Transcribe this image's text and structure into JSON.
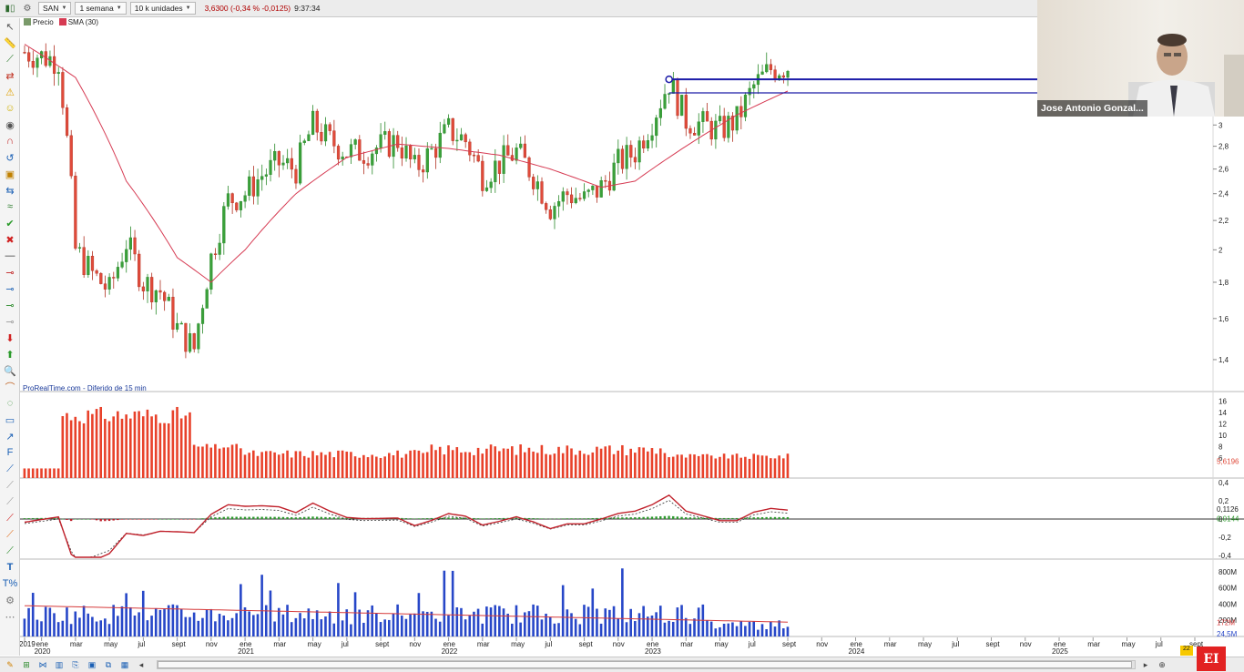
{
  "toolbar": {
    "ticker": "SAN",
    "period": "1 semana",
    "units": "10 k unidades",
    "price_change": "3,6300 (-0,34 % -0,0125)",
    "time": "9:37:34"
  },
  "legend": {
    "price_label": "Precio",
    "sma_label": "SMA (30)",
    "price_color": "#2b8a2b",
    "sma_color": "#d63a52"
  },
  "watermark": "ProRealTime.com - Diferido de 15 min",
  "webcam": {
    "name": "Jose Antonio Gonzal..."
  },
  "badge": "22",
  "logo": "EI",
  "chart_data": [
    {
      "type": "candlestick",
      "title": "",
      "y_ticks": [
        "3",
        "2,8",
        "2,6",
        "2,4",
        "2,2",
        "2",
        "1,8",
        "1,6",
        "1,4"
      ],
      "ylim": [
        1.3,
        3.2
      ],
      "y_scale": "log",
      "x_ticks": [
        "2019",
        "ene",
        "mar",
        "may",
        "jul",
        "sept",
        "nov",
        "ene",
        "mar",
        "may",
        "jul",
        "sept",
        "nov",
        "ene",
        "mar",
        "may",
        "jul",
        "sept",
        "nov",
        "ene",
        "mar",
        "may",
        "jul",
        "sept",
        "nov",
        "ene",
        "mar",
        "may",
        "jul",
        "sept",
        "nov",
        "ene",
        "mar",
        "may",
        "jul",
        "sept"
      ],
      "x_year_labels": [
        "2020",
        "2021",
        "2022",
        "2023",
        "2024",
        "2025"
      ],
      "x_range": [
        "2019-12",
        "2025-09"
      ],
      "series": [
        {
          "name": "Precio",
          "approx_path": [
            [
              "2019-12",
              3.8
            ],
            [
              "2020-02",
              3.7
            ],
            [
              "2020-03",
              2.0
            ],
            [
              "2020-04",
              1.85
            ],
            [
              "2020-05",
              1.75
            ],
            [
              "2020-06",
              2.05
            ],
            [
              "2020-07",
              1.8
            ],
            [
              "2020-08",
              1.75
            ],
            [
              "2020-09",
              1.55
            ],
            [
              "2020-10",
              1.45
            ],
            [
              "2020-11",
              1.95
            ],
            [
              "2020-12",
              2.35
            ],
            [
              "2021-01",
              2.4
            ],
            [
              "2021-02",
              2.55
            ],
            [
              "2021-03",
              2.65
            ],
            [
              "2021-04",
              2.6
            ],
            [
              "2021-05",
              3.0
            ],
            [
              "2021-06",
              2.85
            ],
            [
              "2021-07",
              2.75
            ],
            [
              "2021-08",
              2.75
            ],
            [
              "2021-09",
              2.8
            ],
            [
              "2021-10",
              2.85
            ],
            [
              "2021-11",
              2.6
            ],
            [
              "2021-12",
              2.75
            ],
            [
              "2022-01",
              2.95
            ],
            [
              "2022-02",
              2.85
            ],
            [
              "2022-03",
              2.55
            ],
            [
              "2022-04",
              2.65
            ],
            [
              "2022-05",
              2.75
            ],
            [
              "2022-06",
              2.55
            ],
            [
              "2022-07",
              2.3
            ],
            [
              "2022-08",
              2.4
            ],
            [
              "2022-09",
              2.35
            ],
            [
              "2022-10",
              2.45
            ],
            [
              "2022-11",
              2.65
            ],
            [
              "2022-12",
              2.75
            ],
            [
              "2023-01",
              3.05
            ],
            [
              "2023-02",
              3.45
            ],
            [
              "2023-03",
              3.05
            ],
            [
              "2023-04",
              3.0
            ],
            [
              "2023-05",
              2.95
            ],
            [
              "2023-06",
              3.05
            ],
            [
              "2023-07",
              3.4
            ],
            [
              "2023-08",
              3.6
            ],
            [
              "2023-09",
              3.63
            ]
          ]
        },
        {
          "name": "SMA (30)",
          "approx_path": [
            [
              "2019-12",
              3.9
            ],
            [
              "2020-03",
              3.5
            ],
            [
              "2020-06",
              2.5
            ],
            [
              "2020-09",
              1.95
            ],
            [
              "2020-11",
              1.8
            ],
            [
              "2021-01",
              2.0
            ],
            [
              "2021-04",
              2.4
            ],
            [
              "2021-07",
              2.7
            ],
            [
              "2021-10",
              2.82
            ],
            [
              "2022-01",
              2.78
            ],
            [
              "2022-04",
              2.72
            ],
            [
              "2022-07",
              2.6
            ],
            [
              "2022-10",
              2.45
            ],
            [
              "2022-12",
              2.5
            ],
            [
              "2023-03",
              2.8
            ],
            [
              "2023-06",
              3.1
            ],
            [
              "2023-09",
              3.35
            ]
          ]
        }
      ],
      "horizontal_lines": [
        3.48,
        3.33
      ]
    },
    {
      "type": "bar",
      "title": "",
      "y_ticks": [
        "16",
        "14",
        "12",
        "10",
        "8",
        "6"
      ],
      "last_value_label": "5,6196",
      "color": "#e8412a"
    },
    {
      "type": "line",
      "title": "",
      "y_ticks": [
        "0,4",
        "0,2",
        "0",
        "-0,2",
        "-0,4"
      ],
      "value_labels": [
        "0,1126",
        "0,0144"
      ],
      "line_colors": [
        "#c0202a",
        "#333333"
      ],
      "histogram_colors": [
        "#2f9a2f",
        "#c0202a"
      ]
    },
    {
      "type": "bar",
      "title": "",
      "y_ticks": [
        "800M",
        "600M",
        "400M",
        "200M"
      ],
      "value_labels": [
        "172M",
        "24,5M"
      ],
      "bar_color": "#2747c8",
      "avg_color": "#d63a3a"
    }
  ]
}
